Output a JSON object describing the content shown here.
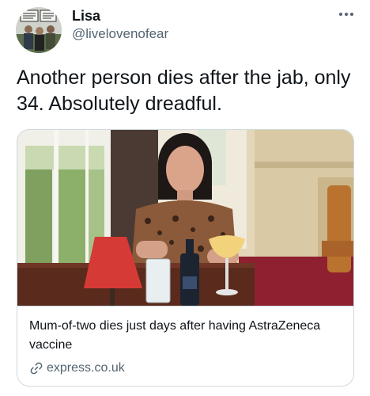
{
  "tweet": {
    "author": {
      "name": "Lisa",
      "handle": "@livelovenofear",
      "avatar_icon": "profile-photo"
    },
    "more_icon": "more-horizontal-icon",
    "text": "Another person dies after the jab, only 34. Absolutely dreadful."
  },
  "card": {
    "title": "Mum-of-two dies just days after having AstraZeneca vaccine",
    "domain": "express.co.uk",
    "link_icon": "link-icon"
  },
  "colors": {
    "primary_text": "#0f1419",
    "secondary_text": "#536471",
    "border": "#cfd9de"
  }
}
